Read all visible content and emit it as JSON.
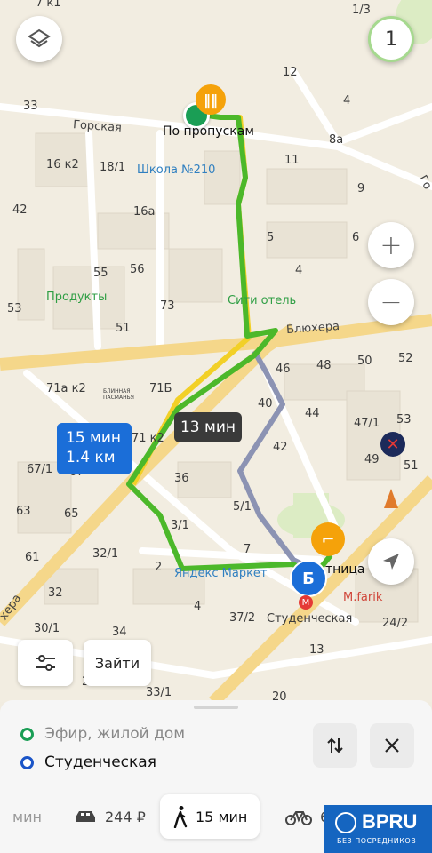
{
  "map": {
    "house_numbers": [
      "1/3",
      "7 к1",
      "12",
      "4",
      "33",
      "8а",
      "16 к2",
      "18/1",
      "11",
      "9",
      "42",
      "16а",
      "5",
      "6",
      "55",
      "56",
      "4",
      "53",
      "73",
      "51",
      "46",
      "48",
      "50",
      "52",
      "71а к2",
      "71Б",
      "44",
      "47/1",
      "53",
      "40",
      "42",
      "49",
      "51",
      "67/1",
      "36",
      "63",
      "65",
      "3/1",
      "5/1",
      "61",
      "32/1",
      "2",
      "7",
      "4",
      "32",
      "37/2",
      "24/2",
      "30/1",
      "34",
      "13",
      "27/1",
      "33/1",
      "20",
      "71 к2",
      "67"
    ],
    "streets": {
      "gorskaya": "Горская",
      "blyukhera": "Блюхера",
      "ekatherinas": "Го",
      "ekatherinas_left": "хера"
    },
    "pois": {
      "school": "Школа №210",
      "products": "Продукты",
      "hotel": "Сити отель",
      "market": "Яндекс Маркет",
      "farik": "M.farik",
      "studencheskaya_metro": "Студенческая",
      "stantsiya_partial": "тница",
      "blinnaya": "БЛИННАЯ ПАСМАНЬЯ"
    },
    "start_label": "По пропускам",
    "finish_marker": "Б",
    "metro_letter": "М",
    "bubble_route": {
      "time": "15 мин",
      "distance": "1.4 км"
    },
    "bubble_alt": "13 мин",
    "layer_count": "1",
    "zoom_in": "+",
    "zoom_out": "−",
    "filters_button": "Зайти",
    "colors": {
      "route_green": "#4cb82a",
      "route_yellow": "#f2d027",
      "route_alt": "#8c93b3",
      "road": "#f5d78a"
    }
  },
  "sheet": {
    "from": "Эфир, жилой дом",
    "to": "Студенческая",
    "modes": [
      {
        "label": "мин",
        "icon": "car-icon"
      },
      {
        "label": "244 ₽",
        "icon": "taxi-icon"
      },
      {
        "label": "15 мин",
        "icon": "walk-icon",
        "active": true
      },
      {
        "label": "6",
        "icon": "bike-icon"
      }
    ],
    "logo": {
      "name": "BPRU",
      "tagline": "БЕЗ ПОСРЕДНИКОВ"
    }
  }
}
